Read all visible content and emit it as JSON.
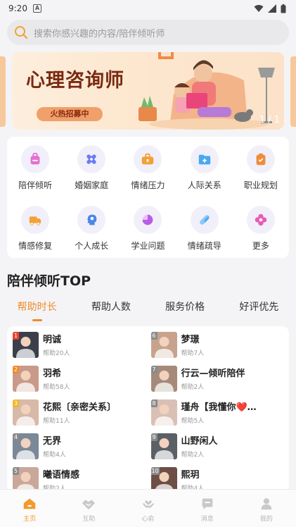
{
  "status_bar": {
    "time": "9:20",
    "notif_badge": "A"
  },
  "search": {
    "placeholder": "搜索你感兴趣的内容/陪伴倾听师"
  },
  "banner": {
    "title": "心理咨询师",
    "tag": "火热招募中",
    "counter": "1 / 1"
  },
  "categories": [
    {
      "label": "陪伴倾听",
      "icon": "bag-icon",
      "color": "#e66fd0"
    },
    {
      "label": "婚姻家庭",
      "icon": "rings-icon",
      "color": "#6a7cf2"
    },
    {
      "label": "情绪压力",
      "icon": "briefcase-icon",
      "color": "#f4a035"
    },
    {
      "label": "人际关系",
      "icon": "folder-icon",
      "color": "#4aa9f0"
    },
    {
      "label": "职业规划",
      "icon": "clipboard-icon",
      "color": "#f08c3a"
    },
    {
      "label": "情感修复",
      "icon": "truck-icon",
      "color": "#f4a035"
    },
    {
      "label": "个人成长",
      "icon": "head-icon",
      "color": "#4b86e8"
    },
    {
      "label": "学业问题",
      "icon": "pie-icon",
      "color": "#b85ee6"
    },
    {
      "label": "情绪疏导",
      "icon": "pill-icon",
      "color": "#4aa9f0"
    },
    {
      "label": "更多",
      "icon": "flower-icon",
      "color": "#e85bb5"
    }
  ],
  "section": {
    "title": "陪伴倾听TOP"
  },
  "tabs": [
    {
      "label": "帮助时长",
      "active": true
    },
    {
      "label": "帮助人数",
      "active": false
    },
    {
      "label": "服务价格",
      "active": false
    },
    {
      "label": "好评优先",
      "active": false
    }
  ],
  "listeners": [
    {
      "rank": "1",
      "name": "明诚",
      "help": "帮助20人",
      "rank_color": "#e8452f",
      "avatar_color": "#3b3f4a"
    },
    {
      "rank": "6",
      "name": "梦璟",
      "help": "帮助7人",
      "rank_color": "#8a8a8a",
      "avatar_color": "#c7a38e"
    },
    {
      "rank": "2",
      "name": "羽希",
      "help": "帮助58人",
      "rank_color": "#f08a2c",
      "avatar_color": "#c9998a"
    },
    {
      "rank": "7",
      "name": "行云—倾听陪伴",
      "help": "帮助2人",
      "rank_color": "#8a8a8a",
      "avatar_color": "#a58a7a"
    },
    {
      "rank": "3",
      "name": "花熙〔亲密关系〕",
      "help": "帮助11人",
      "rank_color": "#f5b52e",
      "avatar_color": "#d7b9a8"
    },
    {
      "rank": "8",
      "name": "瑾舟【我懂你❤️…",
      "help": "帮助5人",
      "rank_color": "#8a8a8a",
      "avatar_color": "#d9c0b5"
    },
    {
      "rank": "4",
      "name": "无界",
      "help": "帮助4人",
      "rank_color": "#8a8a8a",
      "avatar_color": "#7a8898"
    },
    {
      "rank": "9",
      "name": "山野闲人",
      "help": "帮助2人",
      "rank_color": "#8a8a8a",
      "avatar_color": "#5b5f66"
    },
    {
      "rank": "5",
      "name": "曦语情感",
      "help": "帮助2人",
      "rank_color": "#8a8a8a",
      "avatar_color": "#c9a89a"
    },
    {
      "rank": "10",
      "name": "熙玥",
      "help": "帮助4人",
      "rank_color": "#8a8a8a",
      "avatar_color": "#6e4f45"
    }
  ],
  "tabbar": [
    {
      "label": "主页",
      "icon": "home-icon",
      "active": true
    },
    {
      "label": "互助",
      "icon": "handshake-icon",
      "active": false
    },
    {
      "label": "心俞",
      "icon": "hands-heart-icon",
      "active": false
    },
    {
      "label": "消息",
      "icon": "chat-icon",
      "active": false
    },
    {
      "label": "我的",
      "icon": "profile-icon",
      "active": false
    }
  ],
  "colors": {
    "accent": "#f08a2c",
    "banner_title": "#7a2a12"
  }
}
